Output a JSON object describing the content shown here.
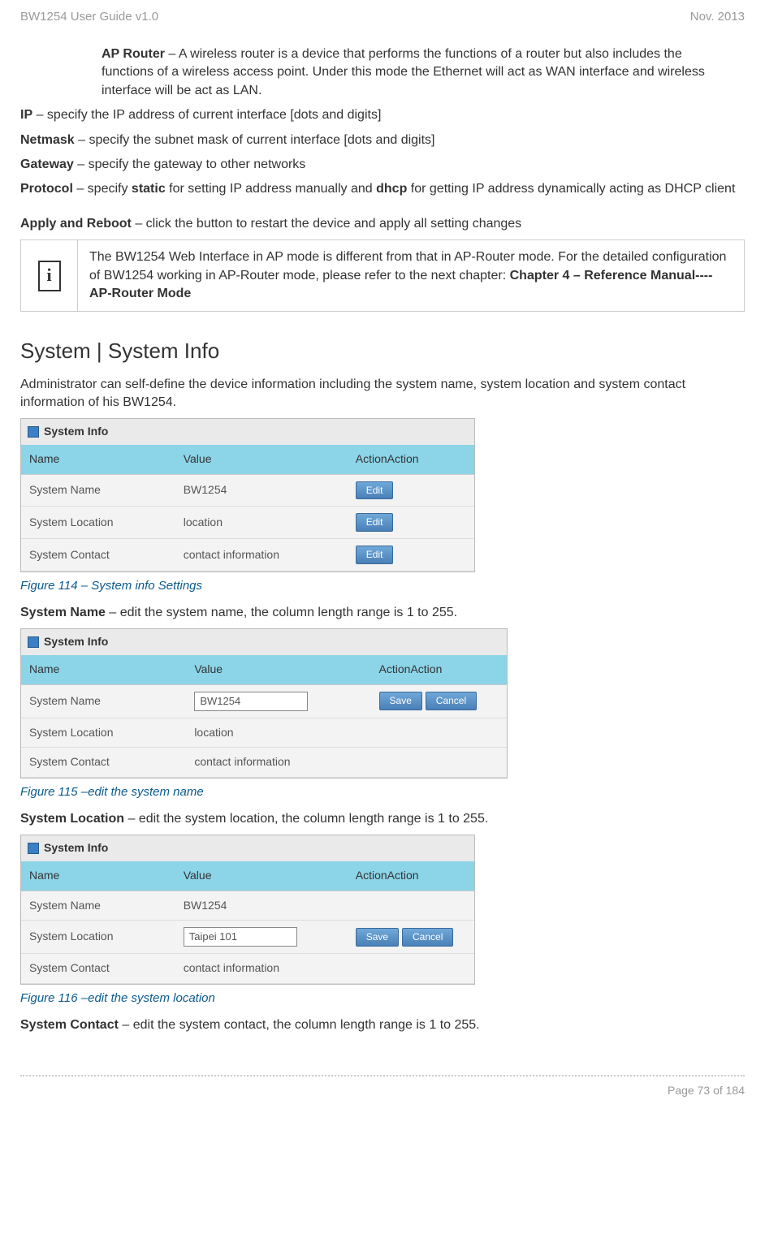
{
  "header": {
    "left": "BW1254 User Guide v1.0",
    "right": "Nov.  2013"
  },
  "ap_router": {
    "label": "AP Router",
    "desc": " – A wireless router is a device that performs the functions of a router but also includes the functions of a wireless access point. Under this mode the Ethernet will act as WAN interface and wireless interface will be act as LAN."
  },
  "ip": {
    "label": "IP",
    "desc": " – specify the IP address of current interface [dots and digits]"
  },
  "netmask": {
    "label": "Netmask",
    "desc": " – specify the subnet mask of current interface [dots and digits]"
  },
  "gateway": {
    "label": "Gateway",
    "desc": " – specify the gateway to other networks"
  },
  "protocol": {
    "label": "Protocol",
    "pre": " – specify ",
    "bold1": "static",
    "mid": " for setting IP address manually and ",
    "bold2": "dhcp",
    "post": " for getting IP address dynamically acting as DHCP client"
  },
  "apply": {
    "label": "Apply and Reboot",
    "desc": " – click the button to restart the device and apply all setting changes"
  },
  "infobox": {
    "pre": "The BW1254 Web Interface in AP mode is different from that in AP-Router mode. For the detailed configuration of BW1254 working in AP-Router mode, please refer to the next chapter: ",
    "bold": "Chapter 4 – Reference Manual----AP-Router Mode"
  },
  "section_title": "System | System Info",
  "section_intro": "Administrator can self-define the device information including the system name, system location and system contact information of his BW1254.",
  "panel_title": "System Info",
  "table_headers": {
    "name": "Name",
    "value": "Value",
    "action": "ActionAction"
  },
  "rows": {
    "name_label": "System Name",
    "location_label": "System Location",
    "contact_label": "System Contact",
    "name_val": "BW1254",
    "location_val": "location",
    "contact_val": "contact information",
    "location_edit_val": "Taipei 101"
  },
  "buttons": {
    "edit": "Edit",
    "save": "Save",
    "cancel": "Cancel"
  },
  "fig114_caption": "Figure 114 – System info Settings",
  "system_name_para": {
    "label": "System Name",
    "desc": " – edit the system name, the column length range is 1 to 255."
  },
  "fig115_caption": "Figure 115 –edit the system name",
  "system_location_para": {
    "label": "System Location",
    "desc": " – edit the system location, the column length range is 1 to 255."
  },
  "fig116_caption": "Figure 116 –edit the system location",
  "system_contact_para": {
    "label": "System Contact",
    "desc": " – edit the system contact, the column length range is 1 to 255."
  },
  "footer": "Page 73 of 184"
}
